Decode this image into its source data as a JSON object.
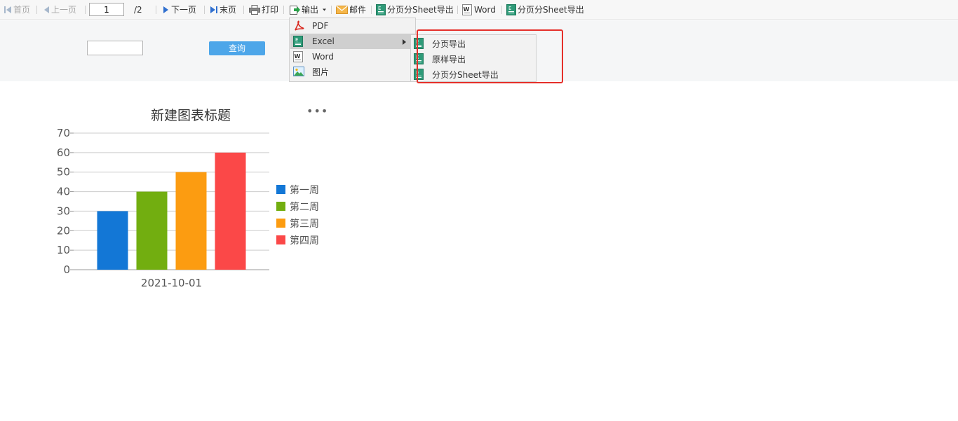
{
  "toolbar": {
    "first": "首页",
    "prev": "上一页",
    "page_value": "1",
    "page_total": "/2",
    "next": "下一页",
    "last": "末页",
    "print": "打印",
    "output": "输出",
    "mail": "邮件",
    "page_sheet_export_1": "分页分Sheet导出",
    "word": "Word",
    "page_sheet_export_2": "分页分Sheet导出"
  },
  "params": {
    "query_label": "查询"
  },
  "output_menu": {
    "items": [
      {
        "label": "PDF",
        "icon": "pdf-icon"
      },
      {
        "label": "Excel",
        "icon": "excel-icon"
      },
      {
        "label": "Word",
        "icon": "word-icon"
      },
      {
        "label": "图片",
        "icon": "image-icon"
      }
    ]
  },
  "excel_submenu": {
    "items": [
      {
        "label": "分页导出",
        "icon": "excel-icon"
      },
      {
        "label": "原样导出",
        "icon": "excel-icon"
      },
      {
        "label": "分页分Sheet导出",
        "icon": "excel-icon"
      }
    ]
  },
  "colors": {
    "highlight": "#e5302a",
    "query_button": "#4da6e9"
  },
  "chart_data": {
    "type": "bar",
    "title": "新建图表标题",
    "categories": [
      "2021-10-01"
    ],
    "series": [
      {
        "name": "第一周",
        "values": [
          30
        ],
        "color": "#1377d6"
      },
      {
        "name": "第二周",
        "values": [
          40
        ],
        "color": "#72ae10"
      },
      {
        "name": "第三周",
        "values": [
          50
        ],
        "color": "#fc9c11"
      },
      {
        "name": "第四周",
        "values": [
          60
        ],
        "color": "#fb4848"
      }
    ],
    "ylim": [
      0,
      70
    ],
    "yticks": [
      "0",
      "10",
      "20",
      "30",
      "40",
      "50",
      "60",
      "70"
    ],
    "grid": true,
    "legend": "right",
    "menu_glyph": "•••"
  }
}
